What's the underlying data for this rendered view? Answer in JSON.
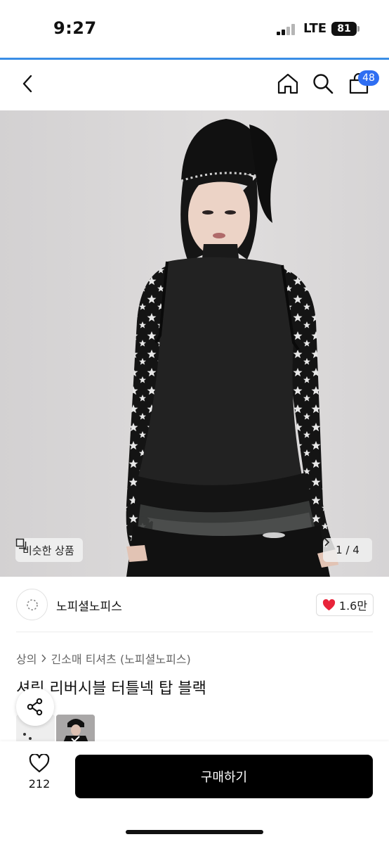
{
  "status": {
    "time": "9:27",
    "network": "LTE",
    "battery": "81"
  },
  "nav": {
    "cart_count": "48"
  },
  "gallery": {
    "similar_label": "비슷한 상품",
    "page_indicator": "1 / 4"
  },
  "shop": {
    "name": "노피셜노피스",
    "likes": "1.6만"
  },
  "breadcrumb": {
    "category": "상의",
    "subcategory": "긴소매 티셔츠 (노피셜노피스)"
  },
  "product": {
    "title": "셔링 리버시블 터틀넥 탑 블랙"
  },
  "bottom": {
    "wish_count": "212",
    "buy_label": "구매하기"
  },
  "colors": {
    "accent_blue": "#2f6ef2",
    "heart_red": "#e8243a",
    "status_line": "#3a8ee6"
  }
}
